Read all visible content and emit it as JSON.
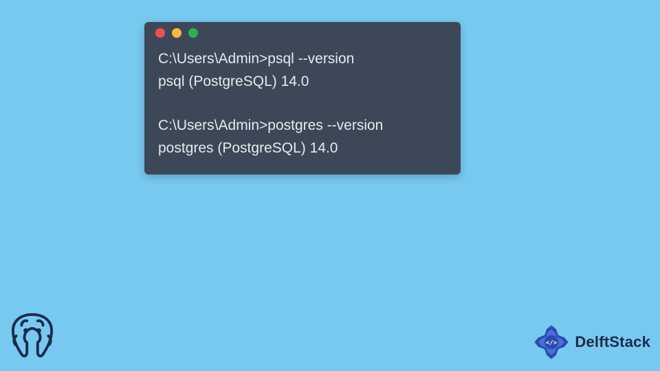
{
  "terminal": {
    "lines": [
      "C:\\Users\\Admin>psql --version",
      "psql (PostgreSQL) 14.0",
      "",
      "C:\\Users\\Admin>postgres --version",
      "postgres (PostgreSQL) 14.0"
    ],
    "titlebar": {
      "dots": [
        "red",
        "yellow",
        "green"
      ]
    }
  },
  "branding": {
    "delftstack_label": "DelftStack"
  }
}
